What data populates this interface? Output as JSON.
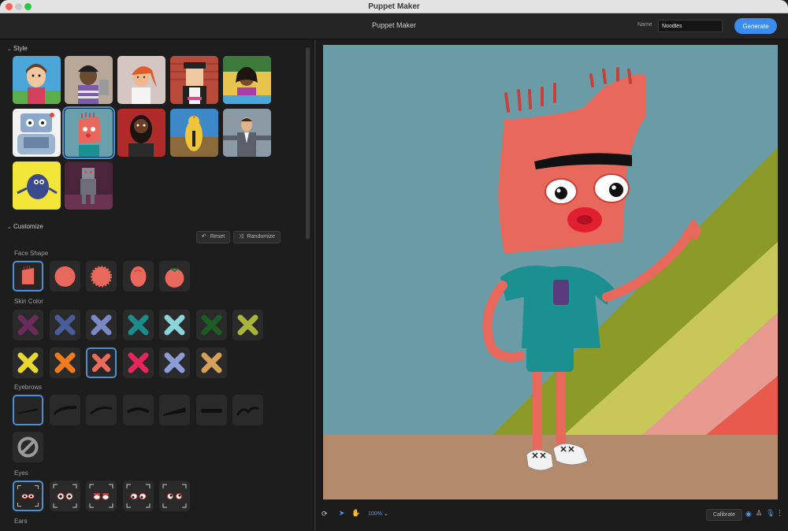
{
  "window": {
    "title": "Puppet Maker"
  },
  "header": {
    "title": "Puppet Maker",
    "name_label": "Name",
    "name_value": "Noodles",
    "generate_label": "Generate"
  },
  "style_section": {
    "title": "Style",
    "thumbnails": [
      {
        "name": "style-cartoon-boy",
        "selected": false
      },
      {
        "name": "style-sketch-kid",
        "selected": false
      },
      {
        "name": "style-redhead-woman",
        "selected": false
      },
      {
        "name": "style-blocky-man",
        "selected": false
      },
      {
        "name": "style-illustrated-woman",
        "selected": false
      },
      {
        "name": "style-robot",
        "selected": false
      },
      {
        "name": "style-noodles",
        "selected": true
      },
      {
        "name": "style-bearded-man",
        "selected": false
      },
      {
        "name": "style-yellow-bird",
        "selected": false
      },
      {
        "name": "style-business-man",
        "selected": false
      },
      {
        "name": "style-blue-monster",
        "selected": false
      },
      {
        "name": "style-pixel-robot",
        "selected": false
      }
    ]
  },
  "customize_section": {
    "title": "Customize",
    "reset_label": "Reset",
    "randomize_label": "Randomize",
    "face_shape_label": "Face Shape",
    "skin_color_label": "Skin Color",
    "eyebrows_label": "Eyebrows",
    "eyes_label": "Eyes",
    "ears_label": "Ears",
    "skin_colors": [
      "#6a2a5c",
      "#4a5c9a",
      "#7c88c4",
      "#1a8c8c",
      "#8ad4dc",
      "#1c5c24",
      "#a8b43a",
      "#e8d82c",
      "#ef7c1c",
      "#e86c5c",
      "#e8245c",
      "#8c9cd4",
      "#d4a05c"
    ],
    "selected_skin_index": 9
  },
  "toolbar": {
    "zoom_label": "100%",
    "calibrate_label": "Calibrate"
  },
  "colors": {
    "accent": "#3b8cf0",
    "selection": "#4a90d9",
    "puppet_skin": "#e8685c",
    "shirt": "#1a9090"
  }
}
